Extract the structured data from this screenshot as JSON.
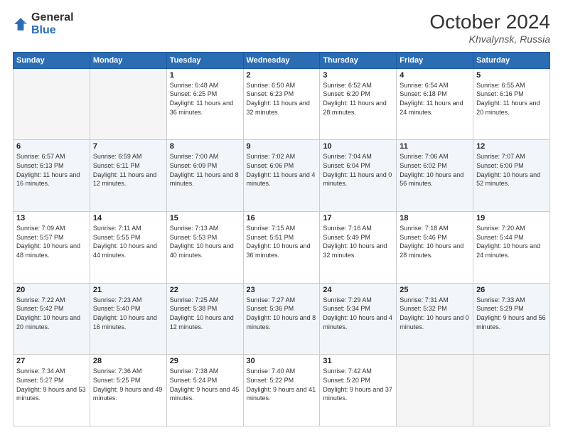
{
  "header": {
    "logo": {
      "general": "General",
      "blue": "Blue"
    },
    "title": "October 2024",
    "subtitle": "Khvalynsk, Russia"
  },
  "days_of_week": [
    "Sunday",
    "Monday",
    "Tuesday",
    "Wednesday",
    "Thursday",
    "Friday",
    "Saturday"
  ],
  "weeks": [
    [
      {
        "day": "",
        "info": ""
      },
      {
        "day": "",
        "info": ""
      },
      {
        "day": "1",
        "info": "Sunrise: 6:48 AM\nSunset: 6:25 PM\nDaylight: 11 hours\nand 36 minutes."
      },
      {
        "day": "2",
        "info": "Sunrise: 6:50 AM\nSunset: 6:23 PM\nDaylight: 11 hours\nand 32 minutes."
      },
      {
        "day": "3",
        "info": "Sunrise: 6:52 AM\nSunset: 6:20 PM\nDaylight: 11 hours\nand 28 minutes."
      },
      {
        "day": "4",
        "info": "Sunrise: 6:54 AM\nSunset: 6:18 PM\nDaylight: 11 hours\nand 24 minutes."
      },
      {
        "day": "5",
        "info": "Sunrise: 6:55 AM\nSunset: 6:16 PM\nDaylight: 11 hours\nand 20 minutes."
      }
    ],
    [
      {
        "day": "6",
        "info": "Sunrise: 6:57 AM\nSunset: 6:13 PM\nDaylight: 11 hours\nand 16 minutes."
      },
      {
        "day": "7",
        "info": "Sunrise: 6:59 AM\nSunset: 6:11 PM\nDaylight: 11 hours\nand 12 minutes."
      },
      {
        "day": "8",
        "info": "Sunrise: 7:00 AM\nSunset: 6:09 PM\nDaylight: 11 hours\nand 8 minutes."
      },
      {
        "day": "9",
        "info": "Sunrise: 7:02 AM\nSunset: 6:06 PM\nDaylight: 11 hours\nand 4 minutes."
      },
      {
        "day": "10",
        "info": "Sunrise: 7:04 AM\nSunset: 6:04 PM\nDaylight: 11 hours\nand 0 minutes."
      },
      {
        "day": "11",
        "info": "Sunrise: 7:06 AM\nSunset: 6:02 PM\nDaylight: 10 hours\nand 56 minutes."
      },
      {
        "day": "12",
        "info": "Sunrise: 7:07 AM\nSunset: 6:00 PM\nDaylight: 10 hours\nand 52 minutes."
      }
    ],
    [
      {
        "day": "13",
        "info": "Sunrise: 7:09 AM\nSunset: 5:57 PM\nDaylight: 10 hours\nand 48 minutes."
      },
      {
        "day": "14",
        "info": "Sunrise: 7:11 AM\nSunset: 5:55 PM\nDaylight: 10 hours\nand 44 minutes."
      },
      {
        "day": "15",
        "info": "Sunrise: 7:13 AM\nSunset: 5:53 PM\nDaylight: 10 hours\nand 40 minutes."
      },
      {
        "day": "16",
        "info": "Sunrise: 7:15 AM\nSunset: 5:51 PM\nDaylight: 10 hours\nand 36 minutes."
      },
      {
        "day": "17",
        "info": "Sunrise: 7:16 AM\nSunset: 5:49 PM\nDaylight: 10 hours\nand 32 minutes."
      },
      {
        "day": "18",
        "info": "Sunrise: 7:18 AM\nSunset: 5:46 PM\nDaylight: 10 hours\nand 28 minutes."
      },
      {
        "day": "19",
        "info": "Sunrise: 7:20 AM\nSunset: 5:44 PM\nDaylight: 10 hours\nand 24 minutes."
      }
    ],
    [
      {
        "day": "20",
        "info": "Sunrise: 7:22 AM\nSunset: 5:42 PM\nDaylight: 10 hours\nand 20 minutes."
      },
      {
        "day": "21",
        "info": "Sunrise: 7:23 AM\nSunset: 5:40 PM\nDaylight: 10 hours\nand 16 minutes."
      },
      {
        "day": "22",
        "info": "Sunrise: 7:25 AM\nSunset: 5:38 PM\nDaylight: 10 hours\nand 12 minutes."
      },
      {
        "day": "23",
        "info": "Sunrise: 7:27 AM\nSunset: 5:36 PM\nDaylight: 10 hours\nand 8 minutes."
      },
      {
        "day": "24",
        "info": "Sunrise: 7:29 AM\nSunset: 5:34 PM\nDaylight: 10 hours\nand 4 minutes."
      },
      {
        "day": "25",
        "info": "Sunrise: 7:31 AM\nSunset: 5:32 PM\nDaylight: 10 hours\nand 0 minutes."
      },
      {
        "day": "26",
        "info": "Sunrise: 7:33 AM\nSunset: 5:29 PM\nDaylight: 9 hours\nand 56 minutes."
      }
    ],
    [
      {
        "day": "27",
        "info": "Sunrise: 7:34 AM\nSunset: 5:27 PM\nDaylight: 9 hours\nand 53 minutes."
      },
      {
        "day": "28",
        "info": "Sunrise: 7:36 AM\nSunset: 5:25 PM\nDaylight: 9 hours\nand 49 minutes."
      },
      {
        "day": "29",
        "info": "Sunrise: 7:38 AM\nSunset: 5:24 PM\nDaylight: 9 hours\nand 45 minutes."
      },
      {
        "day": "30",
        "info": "Sunrise: 7:40 AM\nSunset: 5:22 PM\nDaylight: 9 hours\nand 41 minutes."
      },
      {
        "day": "31",
        "info": "Sunrise: 7:42 AM\nSunset: 5:20 PM\nDaylight: 9 hours\nand 37 minutes."
      },
      {
        "day": "",
        "info": ""
      },
      {
        "day": "",
        "info": ""
      }
    ]
  ]
}
